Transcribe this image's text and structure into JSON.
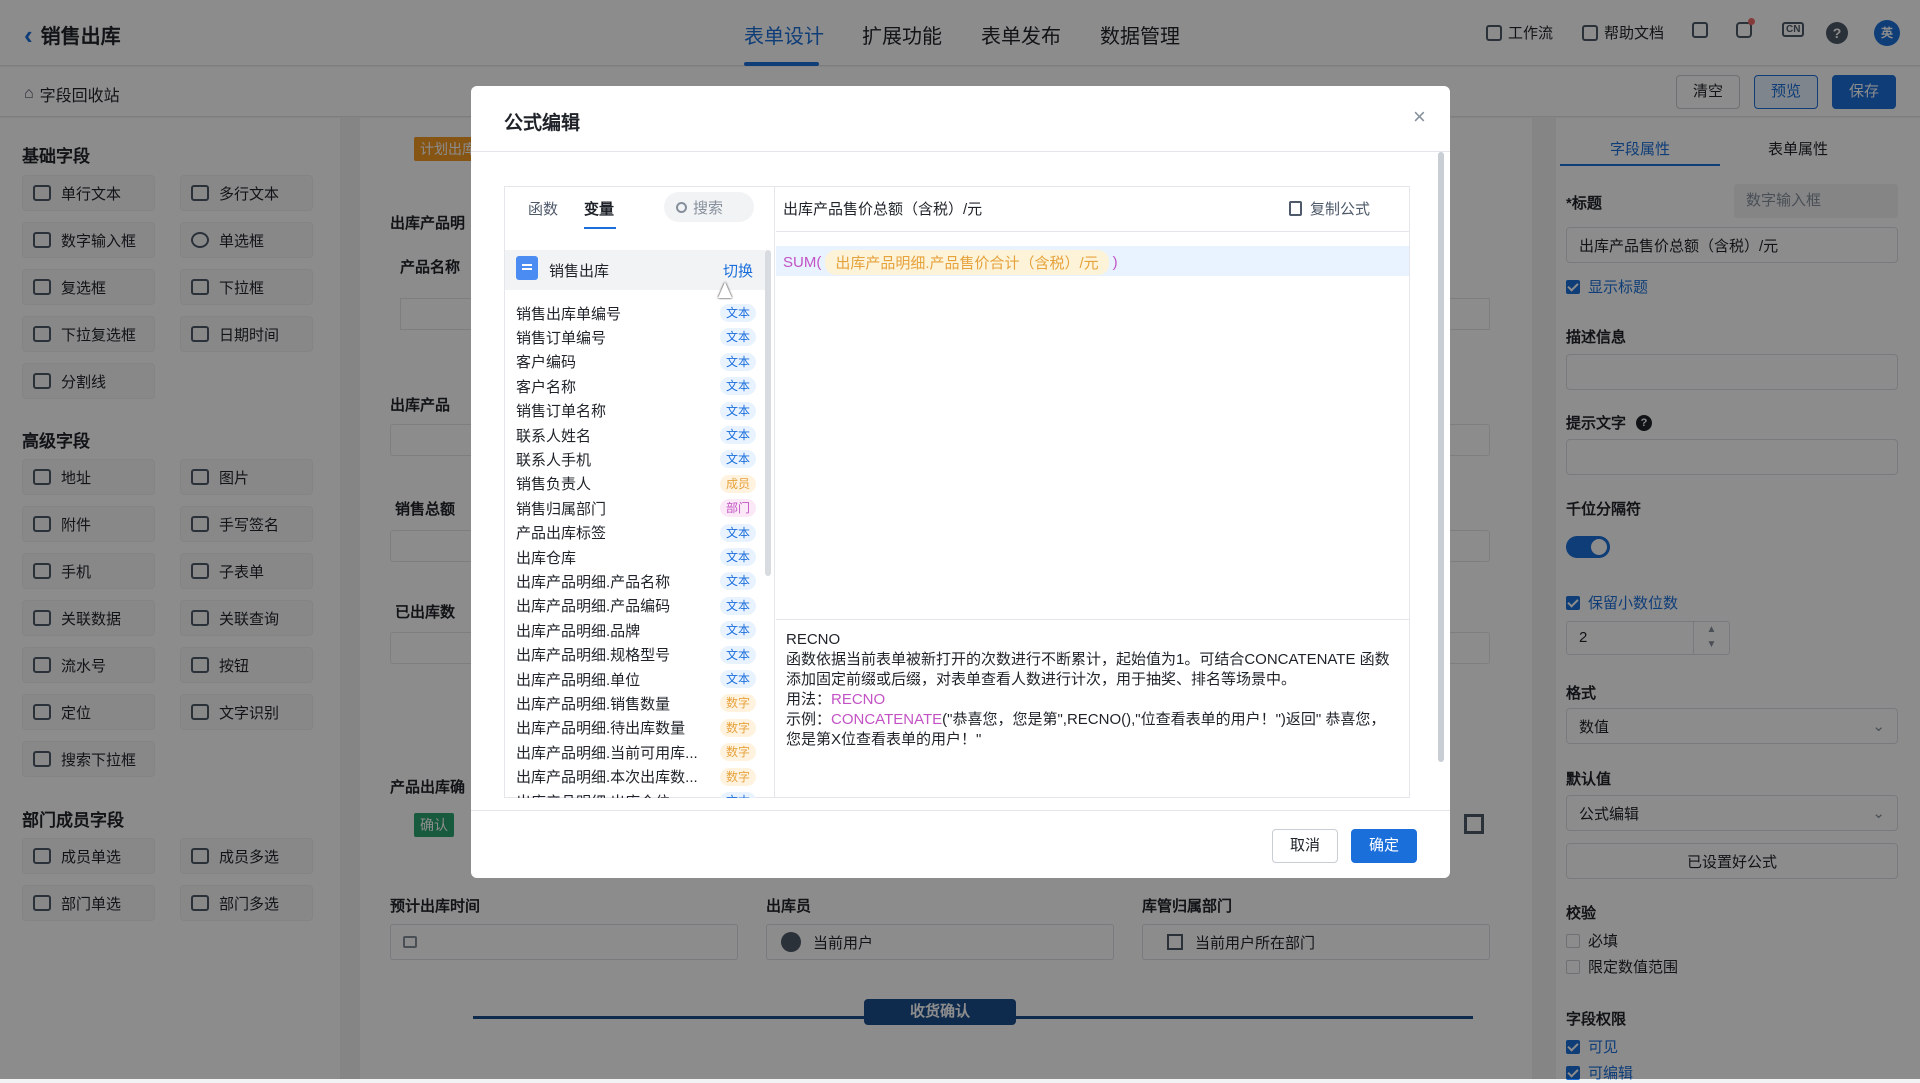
{
  "app": {
    "back_title": "销售出库",
    "nav": [
      "表单设计",
      "扩展功能",
      "表单发布",
      "数据管理"
    ],
    "workflow": "工作流",
    "help_doc": "帮助文档",
    "lang": "CN",
    "help": "?",
    "avatar": "英"
  },
  "subbar": {
    "recycle": "字段回收站",
    "clear": "清空",
    "preview": "预览",
    "save": "保存"
  },
  "left_panel": {
    "basic_title": "基础字段",
    "basic": [
      "单行文本",
      "多行文本",
      "数字输入框",
      "单选框",
      "复选框",
      "下拉框",
      "下拉复选框",
      "日期时间",
      "分割线"
    ],
    "advanced_title": "高级字段",
    "advanced": [
      "地址",
      "图片",
      "附件",
      "手写签名",
      "手机",
      "子表单",
      "关联数据",
      "关联查询",
      "流水号",
      "按钮",
      "定位",
      "文字识别",
      "搜索下拉框"
    ],
    "dept_title": "部门成员字段",
    "dept": [
      "成员单选",
      "成员多选",
      "部门单选",
      "部门多选"
    ]
  },
  "canvas": {
    "plan_tag": "计划出库",
    "label_products": "出库产品明",
    "col_product_name": "产品名称",
    "label_out_products": "出库产品",
    "label_sales_total": "销售总额",
    "label_shipped": "已出库数",
    "label_product_out": "产品出库确",
    "confirm_tag": "确认",
    "expected_time_label": "预计出库时间",
    "operator_label": "出库员",
    "operator_value": "当前用户",
    "dept_label": "库管归属部门",
    "dept_value": "当前用户所在部门",
    "receipt_divider": "收货确认"
  },
  "right_panel": {
    "tab_field": "字段属性",
    "tab_form": "表单属性",
    "title_label": "*标题",
    "title_type": "数字输入框",
    "title_value": "出库产品售价总额（含税）/元",
    "show_title": "显示标题",
    "desc_label": "描述信息",
    "hint_label": "提示文字",
    "thousands_label": "千位分隔符",
    "keep_decimal": "保留小数位数",
    "decimal_value": "2",
    "format_label": "格式",
    "format_value": "数值",
    "default_label": "默认值",
    "default_value": "公式编辑",
    "formula_set": "已设置好公式",
    "validate_label": "校验",
    "required": "必填",
    "range": "限定数值范围",
    "perm_label": "字段权限",
    "visible": "可见",
    "editable": "可编辑"
  },
  "modal": {
    "title": "公式编辑",
    "tab_func": "函数",
    "tab_var": "变量",
    "search_placeholder": "搜索",
    "form_name": "销售出库",
    "switch": "切换",
    "formula_field": "出库产品售价总额（含税）/元",
    "copy_formula": "复制公式",
    "formula_func": "SUM(",
    "formula_arg": "出库产品明细.产品售价合计（含税）/元",
    "formula_close": ")",
    "help_name": "RECNO",
    "help_desc": "函数依据当前表单被新打开的次数进行不断累计，起始值为1。可结合CONCATENATE 函数添加固定前缀或后缀，对表单查看人数进行计次，用于抽奖、排名等场景中。",
    "usage_label": "用法：",
    "usage_value": "RECNO",
    "example_label": "示例：",
    "example_func": "CONCATENATE",
    "example_rest": "(\"恭喜您，您是第\",RECNO(),\"位查看表单的用户！\")返回\" 恭喜您，您是第X位查看表单的用户！\"",
    "cancel": "取消",
    "ok": "确定",
    "variables": [
      {
        "name": "销售出库单编号",
        "type": "文本"
      },
      {
        "name": "销售订单编号",
        "type": "文本"
      },
      {
        "name": "客户编码",
        "type": "文本"
      },
      {
        "name": "客户名称",
        "type": "文本"
      },
      {
        "name": "销售订单名称",
        "type": "文本"
      },
      {
        "name": "联系人姓名",
        "type": "文本"
      },
      {
        "name": "联系人手机",
        "type": "文本"
      },
      {
        "name": "销售负责人",
        "type": "成员"
      },
      {
        "name": "销售归属部门",
        "type": "部门"
      },
      {
        "name": "产品出库标签",
        "type": "文本"
      },
      {
        "name": "出库仓库",
        "type": "文本"
      },
      {
        "name": "出库产品明细.产品名称",
        "type": "文本"
      },
      {
        "name": "出库产品明细.产品编码",
        "type": "文本"
      },
      {
        "name": "出库产品明细.品牌",
        "type": "文本"
      },
      {
        "name": "出库产品明细.规格型号",
        "type": "文本"
      },
      {
        "name": "出库产品明细.单位",
        "type": "文本"
      },
      {
        "name": "出库产品明细.销售数量",
        "type": "数字"
      },
      {
        "name": "出库产品明细.待出库数量",
        "type": "数字"
      },
      {
        "name": "出库产品明细.当前可用库...",
        "type": "数字"
      },
      {
        "name": "出库产品明细.本次出库数...",
        "type": "数字"
      },
      {
        "name": "出库产品明细.出库仓位",
        "type": "文本"
      }
    ]
  }
}
